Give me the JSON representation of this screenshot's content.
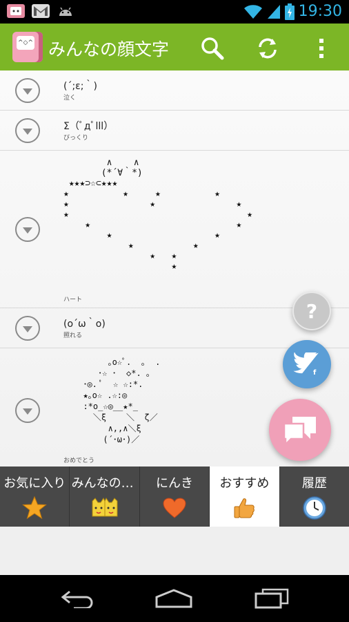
{
  "status_bar": {
    "time": "19:30",
    "left_icons": [
      "app-notification-icon",
      "gmail-icon",
      "android-icon"
    ],
    "right_icons": [
      "wifi-icon",
      "signal-icon",
      "battery-icon"
    ]
  },
  "action_bar": {
    "title": "みんなの顔文字",
    "background": "#7cb626",
    "buttons": [
      "search-icon",
      "refresh-icon",
      "overflow-menu-icon"
    ]
  },
  "list": {
    "items": [
      {
        "kaomoji": "(´;ε;｀)",
        "label": "泣く"
      },
      {
        "kaomoji": "Σ（ﾟдﾟlll）",
        "label": "びっくり"
      },
      {
        "label": "ハート",
        "art": "        ∧    ∧\n       (*´∀｀*)\n ★★★⊃☆⊂★★★\n★          ★     ★          ★\n★               ★               ★\n★                                 ★\n    ★                           ★\n        ★                   ★\n            ★           ★\n                ★   ★\n                    ★"
      },
      {
        "kaomoji": "(o´ω｀o)",
        "label": "照れる"
      },
      {
        "label": "おめでとう",
        "art": "       ｡o☆ﾟ.  ｡  .\n     ･☆ ･  ◇*. ｡\n  ･◎. ﾟ  ☆ ☆:*.\n  ★｡o☆ .☆:◎\n  :*o_☆◎__★*_\n    ＼ξ    ＼  ζ／\n       ∧,,∧＼ξ\n      (´･ω･)／"
      }
    ]
  },
  "floating": {
    "help_label": "?",
    "help_color": "#c8c8c8",
    "twitter_color": "#5b9ed6",
    "chat_color": "#f0a0b8"
  },
  "tabs": [
    {
      "label": "お気に入り",
      "icon": "star-icon",
      "active": false
    },
    {
      "label": "みんなの顔文字",
      "icon": "cat-faces-icon",
      "active": false
    },
    {
      "label": "にんき",
      "icon": "heart-icon",
      "active": false
    },
    {
      "label": "おすすめ",
      "icon": "thumbs-up-icon",
      "active": true
    },
    {
      "label": "履歴",
      "icon": "clock-icon",
      "active": false
    }
  ],
  "nav_bar": {
    "buttons": [
      "back-icon",
      "home-icon",
      "recent-apps-icon"
    ]
  }
}
